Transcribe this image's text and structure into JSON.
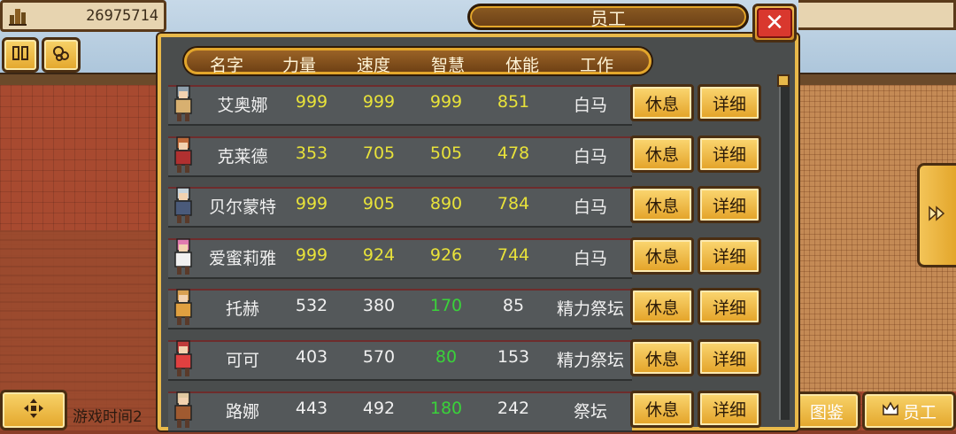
{
  "hud": {
    "money": "26975714",
    "bottom_left_text": "游戏时间2"
  },
  "panel": {
    "title": "员工",
    "close_label": "✕",
    "columns": [
      "名字",
      "力量",
      "速度",
      "智慧",
      "体能",
      "工作"
    ],
    "rest_label": "休息",
    "detail_label": "详细",
    "employees": [
      {
        "name": "艾奥娜",
        "str": "999",
        "spd": "999",
        "wis": "999",
        "sta": "851",
        "job": "白马",
        "stat_color": "#e8e23a",
        "wis_color": "#e8e23a"
      },
      {
        "name": "克莱德",
        "str": "353",
        "spd": "705",
        "wis": "505",
        "sta": "478",
        "job": "白马",
        "stat_color": "#e8e23a",
        "wis_color": "#e8e23a"
      },
      {
        "name": "贝尔蒙特",
        "str": "999",
        "spd": "905",
        "wis": "890",
        "sta": "784",
        "job": "白马",
        "stat_color": "#e8e23a",
        "wis_color": "#e8e23a"
      },
      {
        "name": "爱蜜莉雅",
        "str": "999",
        "spd": "924",
        "wis": "926",
        "sta": "744",
        "job": "白马",
        "stat_color": "#e8e23a",
        "wis_color": "#e8e23a"
      },
      {
        "name": "托赫",
        "str": "532",
        "spd": "380",
        "wis": "170",
        "sta": "85",
        "job": "精力祭坛",
        "stat_color": "#f0f0f0",
        "wis_color": "#3ad23a"
      },
      {
        "name": "可可",
        "str": "403",
        "spd": "570",
        "wis": "80",
        "sta": "153",
        "job": "精力祭坛",
        "stat_color": "#f0f0f0",
        "wis_color": "#3ad23a"
      },
      {
        "name": "路娜",
        "str": "443",
        "spd": "492",
        "wis": "180",
        "sta": "242",
        "job": "祭坛",
        "stat_color": "#f0f0f0",
        "wis_color": "#3ad23a"
      }
    ]
  },
  "bottom_buttons": {
    "encyclopedia": "图鉴",
    "staff": "员工"
  },
  "icons": {
    "money": "building-icon",
    "pause": "pause-icon",
    "settings": "gears-icon",
    "dpad": "dpad-icon",
    "next": "double-chevron-right-icon",
    "staff": "crown-icon"
  }
}
